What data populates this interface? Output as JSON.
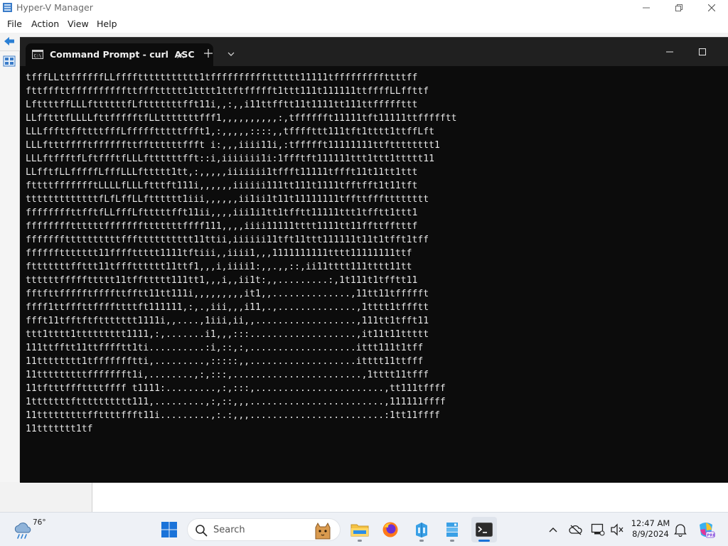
{
  "background_app": {
    "title": "Hyper-V Manager",
    "menu": [
      "File",
      "Action",
      "View",
      "Help"
    ]
  },
  "terminal": {
    "tab_title": "Command Prompt - curl  ASC",
    "output_lines": [
      "tfffLLttffffffLLffffttttttttttt1tfffffffffftttttt11111tfffffffffttttff",
      "fttfffttffffffffffttffftttttt1tttt1ttftffffft1ttt111t111111ttffffLLffttf",
      "LfttttffLLLfttttttfLftttttttfft11i,,:,,i11ttfftt11t1111tt111ttfffffttt",
      "LLfftttfLLLLfttffffftfLLtttttttfff1,,,,,,,,,,:,tfffffft11111tft11111ttffffftt",
      "LLLfffttffttttfffLffffftttttffft1,:,,,,,::::,,tffffttt111tft1tttt1ttffLft",
      "LLLftttfffftffffffttffttttttffft i:,,,iiii11i,:tffffft11111111ttftttttttt1",
      "LLLftffftfLftffftfLLLfttttttfft::i,iiiiiii1i:1ffftft111111ttt1ttt1ttttt11",
      "LLfftfLLfffffLfffLLLfttttt1tt,:,,,,,iiiiiii1tffft11111tffft11t11tt1ttt",
      "fttttffffffftLLLLfLLLftttft111i,,,,,,iiiiii111tt111t1111tfftfft1t11tft",
      "tttttttttttttfLfLffLLftttttt1iii,,,,,,ii1ii1t11t11111111tffttffftttttttt",
      "ffffffffttfftfLLfffLftttttfft11ii,,,,iii1i1tt1tfftt11111ttt1tfftt1ttt1",
      "ffffffffttttttffffffftttttttffff111,,,,iiii11111tttt1111tt11ffttfftttf",
      "fffffffttttttttttffftttttttttt11ttii,iiiiii11tft11ttt111111t11t1tfft1tff",
      "ffffffttttttt11ffffttttt1111tftiii,,iiii1,,,1111111111tttt11111111ttf",
      "ftttttttffttt11tffftttttt11ttf1,,,i,iiii1:,,.,,::,ii11tttt111tttt11tt",
      "ttttttfffffttttt11tffttttt111tt1,,,i,,ii1t:,,.........:,1t111t1tfftt11",
      "fftfttffffftffffttfftt11tt111i,,,,,,,,,it1,,..............,11tt11tffffft",
      "ffff1ttfffttffffttttft111111,:,.,iii,,,i11,.,..............,1tttt1tffftt",
      "ffft11tfftftfttttttt1111i,,....,1iii,ii,,..................,111tt1tfft11",
      "ttt1tttt1ttttttttt1111,:,.......i1,,,:::...................,it11t11ttttt",
      "111ttfftt11ttfffftt1ti..........:i,::,:,...................ittt111t1tff",
      "11tttttttt1tffffffftti,.........,:::::,,...................itttt11ttfff",
      "11tttttttttffffffft1i,........,:,:::,.......................,1tttt11tfff",
      "11tftttfffttttffff t1111:.........,:,:::,.......................,tt111tffff",
      "1tttttttftttttttttt111,.........,:,::,,,........................,111111ffff",
      "11tttttttttffttttffft11i.........,:.:,,,........................:1tt11ffff",
      "11ttttttt1tf"
    ]
  },
  "taskbar": {
    "weather_temp": "76°",
    "search_label": "Search",
    "clock_time": "12:47 AM",
    "clock_date": "8/9/2024"
  },
  "colors": {
    "terminal_bg": "#0c0c0c",
    "terminal_tabbar": "#202020",
    "accent_blue": "#1a73d9",
    "taskbar_bg": "#eef1f6"
  }
}
